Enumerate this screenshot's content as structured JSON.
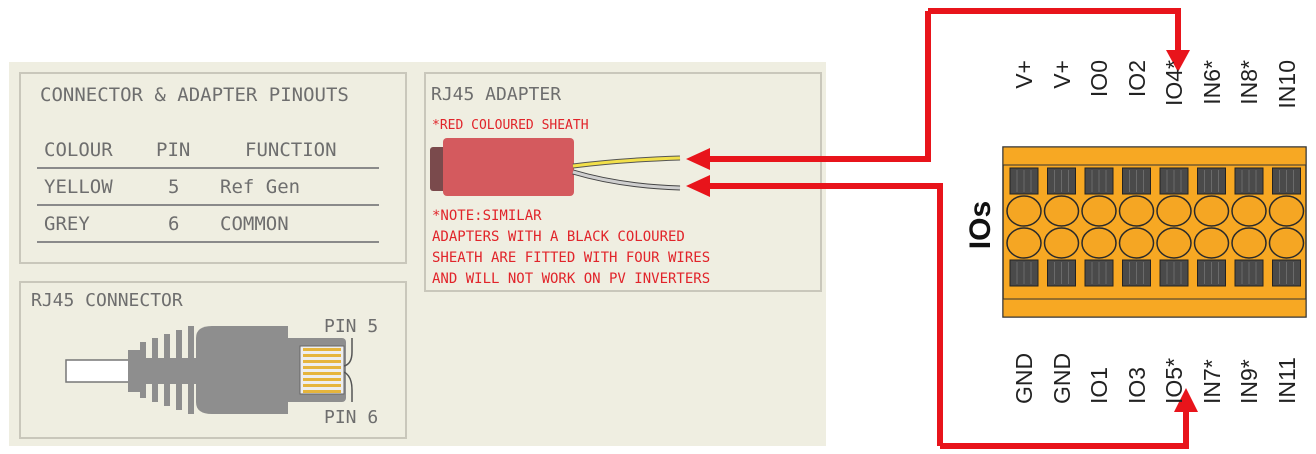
{
  "pinouts": {
    "title": "CONNECTOR & ADAPTER PINOUTS",
    "headers": [
      "COLOUR",
      "PIN",
      "FUNCTION"
    ],
    "rows": [
      [
        "YELLOW",
        "5",
        "Ref Gen"
      ],
      [
        "GREY",
        "6",
        "COMMON"
      ]
    ]
  },
  "rj45_connector": {
    "title": "RJ45 CONNECTOR",
    "pin_top": "PIN 5",
    "pin_bottom": "PIN 6"
  },
  "rj45_adapter": {
    "title": "RJ45 ADAPTER",
    "sheath_note": "*RED COLOURED SHEATH",
    "note_lines": [
      "*NOTE:SIMILAR",
      "ADAPTERS WITH A BLACK COLOURED",
      "SHEATH ARE FITTED WITH FOUR WIRES",
      "AND WILL NOT WORK ON PV INVERTERS"
    ]
  },
  "ios": {
    "title": "IOs",
    "top_labels": [
      "V+",
      "V+",
      "IO0",
      "IO2",
      "IO4*",
      "IN6*",
      "IN8*",
      "IN10"
    ],
    "bottom_labels": [
      "GND",
      "GND",
      "IO1",
      "IO3",
      "IO5*",
      "IN7*",
      "IN9*",
      "IN11"
    ]
  },
  "colors": {
    "panel": "#efeee1",
    "arrow": "#e8141b",
    "terminal": "#f7a823",
    "sheath": "#d45a5e",
    "note_text": "#e1242a"
  }
}
